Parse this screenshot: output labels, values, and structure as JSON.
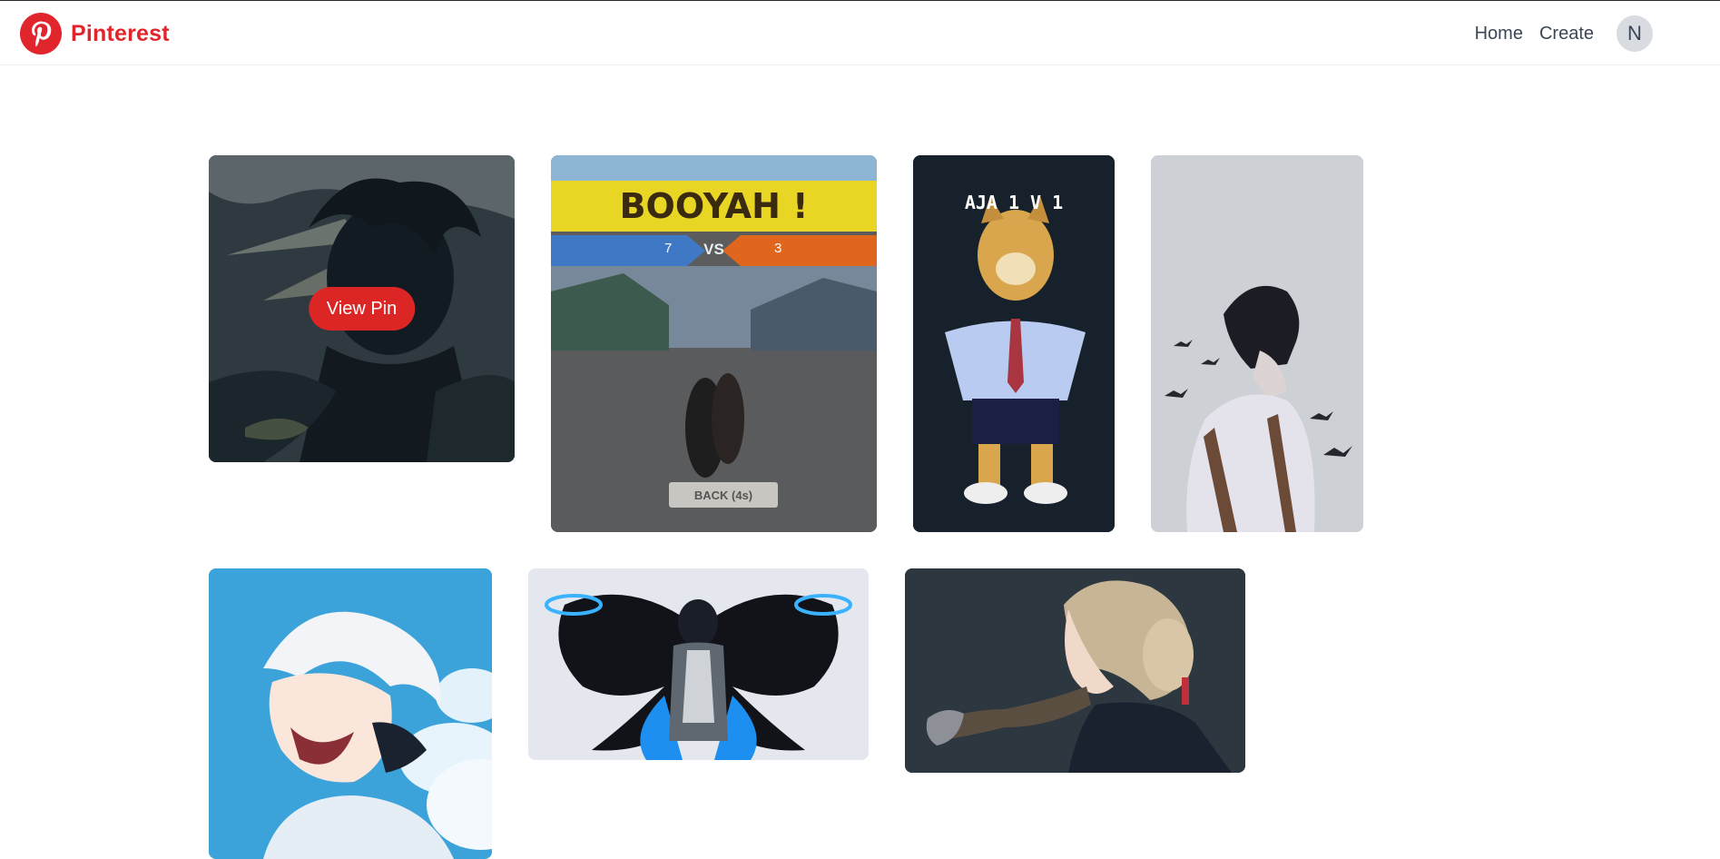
{
  "navbar": {
    "brand": "Pinterest",
    "links": {
      "home": "Home",
      "create": "Create"
    },
    "avatar_initial": "N",
    "brand_color": "#e0262c"
  },
  "pins": {
    "view_pin_label": "View Pin",
    "items": [
      {
        "image": "Anime character silhouette in dark blue-green tones"
      },
      {
        "image": "Game screenshot of two players in a village street",
        "banner": "BOOYAH !",
        "score_left": "7",
        "vs": "VS",
        "score_right": "3",
        "back_label": "BACK (4s)"
      },
      {
        "image": "Doge meme in school uniform",
        "caption": "AJA 1 V 1"
      },
      {
        "image": "Boy profile with flying birds"
      },
      {
        "image": "Laughing white-haired anime boy against sky"
      },
      {
        "image": "Anime character with black butterfly wings"
      },
      {
        "image": "Anime girl with braided hair and mechanical hand"
      }
    ]
  },
  "accent_red": "#dc2626"
}
